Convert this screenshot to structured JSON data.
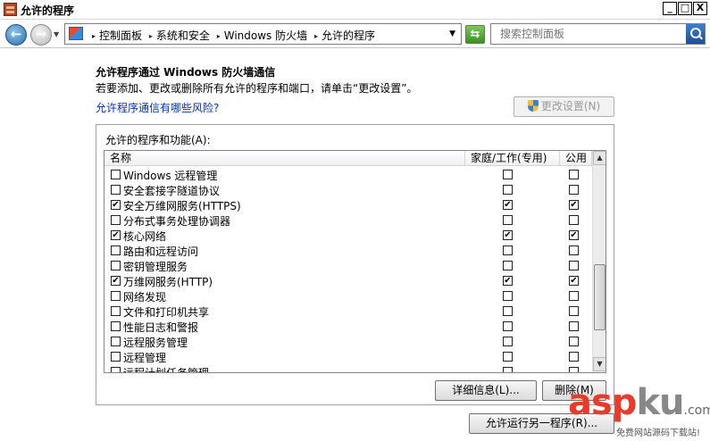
{
  "window": {
    "title": "允许的程序",
    "buttons": {
      "minimize": "_",
      "maximize": "□",
      "close": "X"
    }
  },
  "address_bar": {
    "breadcrumbs": [
      "控制面板",
      "系统和安全",
      "Windows 防火墙",
      "允许的程序"
    ],
    "search_placeholder": "搜索控制面板"
  },
  "main": {
    "heading": "允许程序通过 Windows 防火墙通信",
    "description": "若要添加、更改或删除所有允许的程序和端口，请单击“更改设置”。",
    "risk_link": "允许程序通信有哪些风险?",
    "change_settings_button": "更改设置(N)",
    "group_label": "允许的程序和功能(A):",
    "columns": {
      "name": "名称",
      "home_work": "家庭/工作(专用)",
      "public": "公用"
    },
    "programs": [
      {
        "name": "Windows 远程管理",
        "enabled": false,
        "home_work": false,
        "public": false
      },
      {
        "name": "安全套接字隧道协议",
        "enabled": false,
        "home_work": false,
        "public": false
      },
      {
        "name": "安全万维网服务(HTTPS)",
        "enabled": true,
        "home_work": true,
        "public": true
      },
      {
        "name": "分布式事务处理协调器",
        "enabled": false,
        "home_work": false,
        "public": false
      },
      {
        "name": "核心网络",
        "enabled": true,
        "home_work": true,
        "public": true
      },
      {
        "name": "路由和远程访问",
        "enabled": false,
        "home_work": false,
        "public": false
      },
      {
        "name": "密钥管理服务",
        "enabled": false,
        "home_work": false,
        "public": false
      },
      {
        "name": "万维网服务(HTTP)",
        "enabled": true,
        "home_work": true,
        "public": true
      },
      {
        "name": "网络发现",
        "enabled": false,
        "home_work": false,
        "public": false
      },
      {
        "name": "文件和打印机共享",
        "enabled": false,
        "home_work": false,
        "public": false
      },
      {
        "name": "性能日志和警报",
        "enabled": false,
        "home_work": false,
        "public": false
      },
      {
        "name": "远程服务管理",
        "enabled": false,
        "home_work": false,
        "public": false
      },
      {
        "name": "远程管理",
        "enabled": false,
        "home_work": false,
        "public": false
      },
      {
        "name": "远程计划任务管理",
        "enabled": false,
        "home_work": false,
        "public": false
      }
    ],
    "details_button": "详细信息(L)...",
    "remove_button": "删除(M)",
    "allow_another_button": "允许运行另一程序(R)..."
  },
  "watermark": {
    "asp": "asp",
    "ku": "ku",
    "com": ".com",
    "sub": "免费网站源码下载站!"
  }
}
